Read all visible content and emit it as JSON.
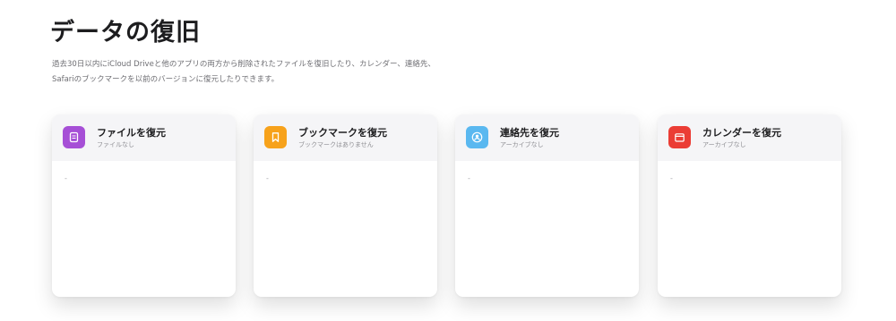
{
  "page": {
    "title": "データの復旧",
    "description": "過去30日以内にiCloud Driveと他のアプリの両方から削除されたファイルを復旧したり、カレンダー、連絡先、Safariのブックマークを以前のバージョンに復元したりできます。"
  },
  "cards": [
    {
      "title": "ファイルを復元",
      "subtitle": "ファイルなし",
      "icon": "document-icon",
      "color": "#a64fd6",
      "placeholder": "-"
    },
    {
      "title": "ブックマークを復元",
      "subtitle": "ブックマークはありません",
      "icon": "bookmark-icon",
      "color": "#f7a21b",
      "placeholder": "-"
    },
    {
      "title": "連絡先を復元",
      "subtitle": "アーカイブなし",
      "icon": "contact-icon",
      "color": "#5ab8f0",
      "placeholder": "-"
    },
    {
      "title": "カレンダーを復元",
      "subtitle": "アーカイブなし",
      "icon": "calendar-icon",
      "color": "#eb3d35",
      "placeholder": "-"
    }
  ]
}
